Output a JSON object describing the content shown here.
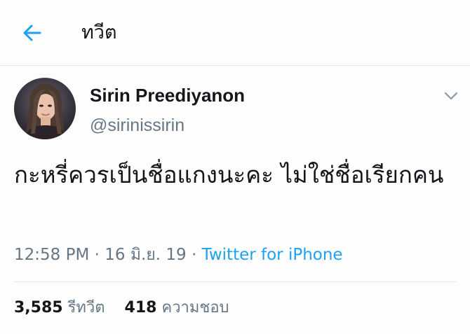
{
  "header": {
    "back_icon": "arrow-left-icon",
    "title": "ทวีต"
  },
  "tweet": {
    "display_name": "Sirin Preediyanon",
    "handle": "@sirinissirin",
    "menu_icon": "chevron-down-icon",
    "text": "กะหรี่ควรเป็นชื่อแกงนะคะ ไม่ใช่ชื่อเรียกคน",
    "time": "12:58 PM",
    "separator": "·",
    "date": "16 มิ.ย. 19",
    "source": "Twitter for iPhone",
    "retweets": {
      "count": "3,585",
      "label": "รีทวีต"
    },
    "likes": {
      "count": "418",
      "label": "ความชอบ"
    }
  },
  "colors": {
    "accent": "#1da1f2",
    "secondary_text": "#657786",
    "primary_text": "#14171a",
    "divider": "#e1e8ed"
  }
}
